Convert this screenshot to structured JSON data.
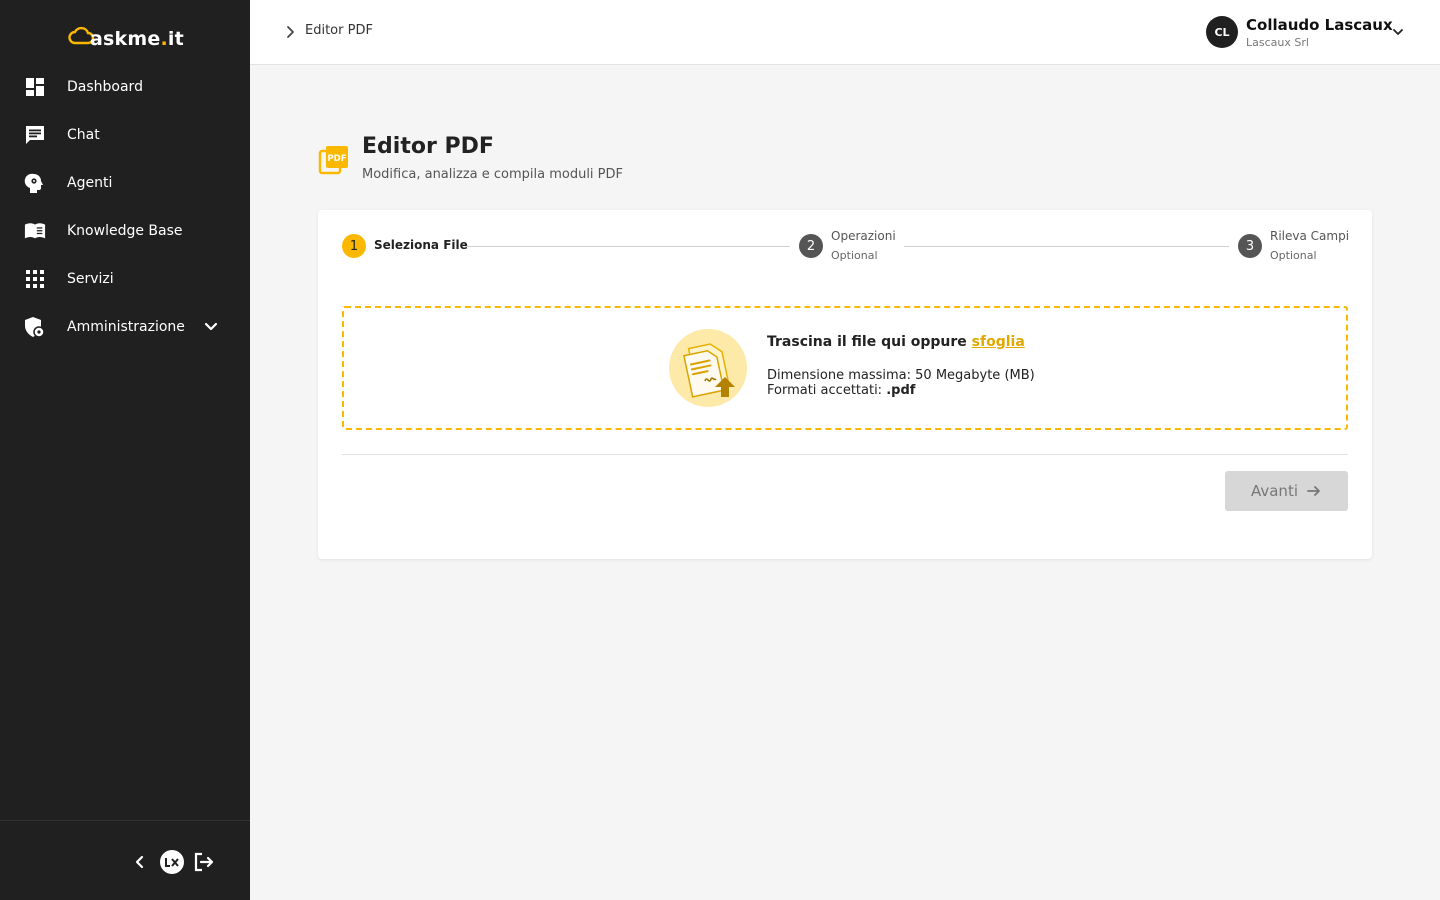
{
  "brand": {
    "name_prefix": "askme",
    "name_dot": ".",
    "name_suffix": "it",
    "accent_color": "#fbb800"
  },
  "sidebar": {
    "items": [
      {
        "label": "Dashboard",
        "icon": "dashboard-icon"
      },
      {
        "label": "Chat",
        "icon": "chat-icon"
      },
      {
        "label": "Agenti",
        "icon": "agent-head-icon"
      },
      {
        "label": "Knowledge Base",
        "icon": "book-icon"
      },
      {
        "label": "Servizi",
        "icon": "grid-icon"
      },
      {
        "label": "Amministrazione",
        "icon": "admin-shield-icon",
        "expandable": true
      }
    ],
    "footer": {
      "collapse_icon": "chevron-left-icon",
      "badge_text": "LX",
      "logout_icon": "logout-icon"
    }
  },
  "header": {
    "breadcrumb": "Editor PDF",
    "user": {
      "initials": "CL",
      "name": "Collaudo Lascaux",
      "org": "Lascaux Srl"
    }
  },
  "page": {
    "title": "Editor PDF",
    "subtitle": "Modifica, analizza e compila moduli PDF",
    "icon": "pdf-icon"
  },
  "stepper": {
    "active_index": 0,
    "steps": [
      {
        "number": "1",
        "label": "Seleziona File",
        "optional": ""
      },
      {
        "number": "2",
        "label": "Operazioni",
        "optional": "Optional"
      },
      {
        "number": "3",
        "label": "Rileva Campi",
        "optional": "Optional"
      }
    ]
  },
  "dropzone": {
    "title": "Trascina il file qui oppure",
    "link": "sfoglia",
    "max_size": "Dimensione massima: 50 Megabyte (MB)",
    "formats_label": "Formati accettati:",
    "formats_value": ".pdf"
  },
  "actions": {
    "next_label": "Avanti",
    "next_enabled": false
  }
}
